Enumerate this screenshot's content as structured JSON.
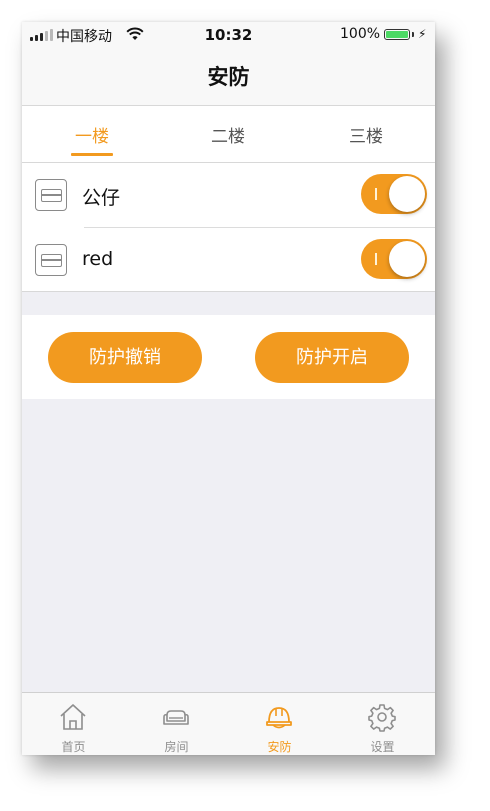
{
  "status_bar": {
    "carrier": "中国移动",
    "time": "10:32",
    "battery_percent": "100%",
    "battery_level": 1.0,
    "wifi_icon": "wifi-icon",
    "signal_icon": "signal-icon",
    "charging_icon": "charging-bolt-icon"
  },
  "nav": {
    "title": "安防"
  },
  "floors": {
    "tabs": [
      {
        "label": "一楼",
        "active": true
      },
      {
        "label": "二楼",
        "active": false
      },
      {
        "label": "三楼",
        "active": false
      }
    ]
  },
  "devices": [
    {
      "name": "公仔",
      "icon": "sensor-device-icon",
      "enabled": true
    },
    {
      "name": "red",
      "icon": "sensor-device-icon",
      "enabled": true
    }
  ],
  "actions": {
    "disarm_label": "防护撤销",
    "arm_label": "防护开启"
  },
  "tabbar": {
    "items": [
      {
        "label": "首页",
        "icon": "home-icon",
        "active": false
      },
      {
        "label": "房间",
        "icon": "sofa-icon",
        "active": false
      },
      {
        "label": "安防",
        "icon": "helmet-icon",
        "active": true
      },
      {
        "label": "设置",
        "icon": "gear-icon",
        "active": false
      }
    ]
  },
  "colors": {
    "accent": "#f29a1f",
    "background": "#efeff4",
    "inactive": "#8e8e8e",
    "battery": "#4cd964"
  }
}
